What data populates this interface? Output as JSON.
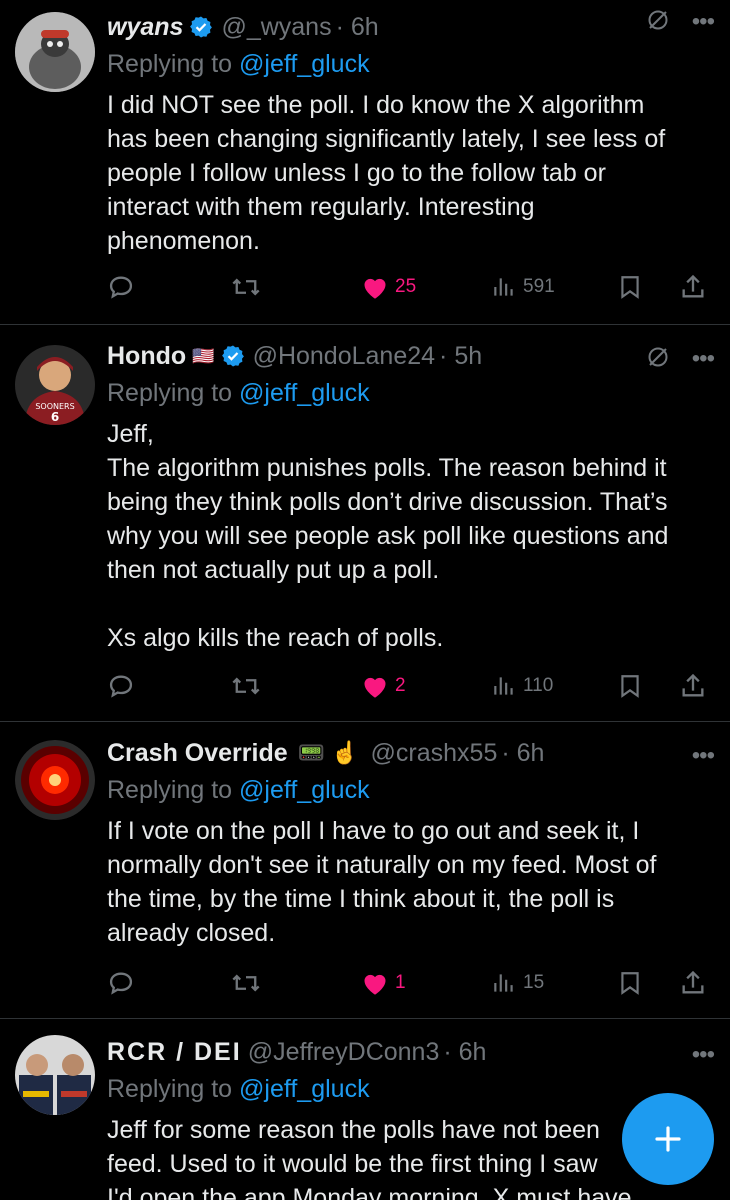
{
  "tweets": [
    {
      "name": "wyans",
      "handle": "@_wyans",
      "time": "· 6h",
      "replying_prefix": "Replying to ",
      "replying_to": "@jeff_gluck",
      "text": "I did NOT see the poll. I do know the X algorithm\nhas been changing significantly lately, I see less of\npeople I follow unless I go to the follow tab or\ninteract with them regularly. Interesting\nphenomenon.",
      "likes": "25",
      "views": "591",
      "liked": true
    },
    {
      "name": "Hondo",
      "flag": "🇺🇸",
      "handle": "@HondoLane24",
      "time": "· 5h",
      "replying_prefix": "Replying to ",
      "replying_to": "@jeff_gluck",
      "text": "Jeff,\nThe algorithm punishes polls. The reason behind it\nbeing they think polls don’t drive discussion. That’s\nwhy you will see people ask poll like questions and\nthen not actually put up a poll.\n\nXs algo kills the reach of polls.",
      "likes": "2",
      "views": "110",
      "liked": true
    },
    {
      "name": "Crash Override",
      "emoji": "📟 ☝️",
      "handle": "@crashx55",
      "time": "· 6h",
      "replying_prefix": "Replying to ",
      "replying_to": "@jeff_gluck",
      "text": "If I vote on the poll I have to go out and seek it, I\nnormally don't see it naturally on my feed. Most of\nthe time, by the time I think about it, the poll is\nalready closed.",
      "likes": "1",
      "views": "15",
      "liked": true
    },
    {
      "name": "RCR / DEI",
      "handle": "@JeffreyDConn3",
      "time": "· 6h",
      "replying_prefix": "Replying to ",
      "replying_to": "@jeff_gluck",
      "text": "Jeff for some reason the polls have not been\nfeed. Used to it would be the first thing I saw\nI'd open the app Monday morning. X must have"
    }
  ],
  "icons": {
    "reply": "reply-icon",
    "repost": "repost-icon",
    "like": "heart-icon",
    "views": "views-icon",
    "bookmark": "bookmark-icon",
    "share": "share-icon",
    "compose": "plus-icon"
  },
  "colors": {
    "background": "#000000",
    "text": "#e7e9ea",
    "muted": "#71767b",
    "link": "#1d9bf0",
    "like": "#f91880",
    "verified": "#1d9bf0"
  }
}
